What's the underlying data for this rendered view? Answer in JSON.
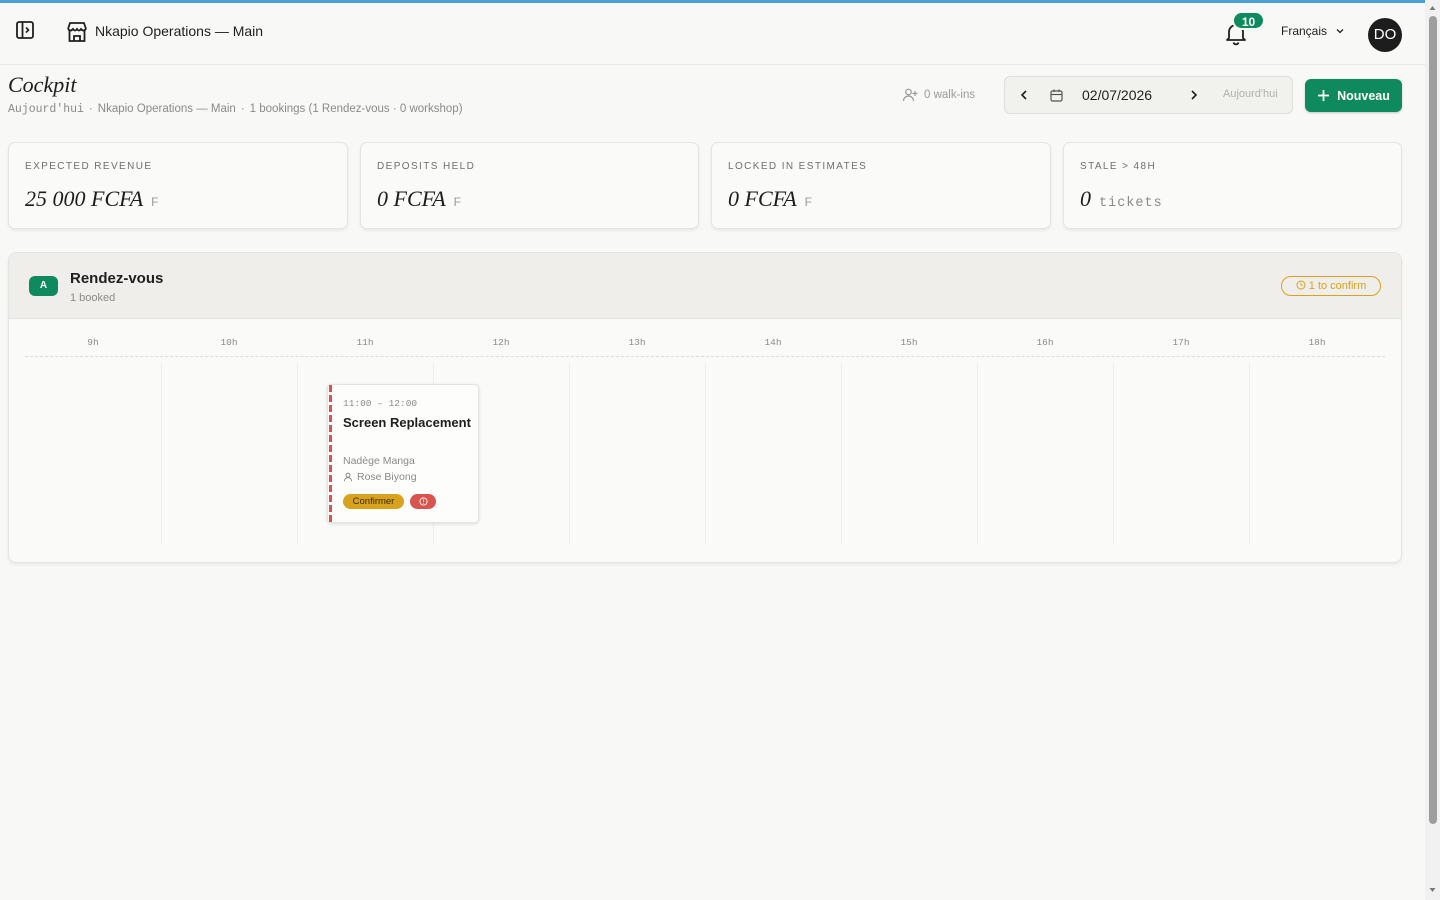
{
  "header": {
    "app_title": "Nkapio Operations — Main",
    "notification_count": "10",
    "language": "Français",
    "avatar_initials": "DO"
  },
  "page": {
    "title": "Cockpit",
    "subtitle": {
      "today": "Aujourd'hui",
      "location": "Nkapio Operations — Main",
      "bookings": "1 bookings (1 Rendez-vous · 0 workshop)"
    },
    "walkins": "0 walk-ins",
    "date": "02/07/2026",
    "today_button": "Aujourd'hui",
    "new_button": "Nouveau"
  },
  "kpis": [
    {
      "label": "Expected revenue",
      "value": "25 000 FCFA",
      "unit": "F"
    },
    {
      "label": "Deposits held",
      "value": "0 FCFA",
      "unit": "F"
    },
    {
      "label": "Locked in estimates",
      "value": "0 FCFA",
      "unit": "F"
    },
    {
      "label": "Stale > 48h",
      "value": "0",
      "unit": "tickets"
    }
  ],
  "schedule": {
    "lane_badge": "A",
    "lane_title": "Rendez-vous",
    "lane_sub": "1 booked",
    "confirm_pill": "1 to confirm",
    "hours": [
      "9h",
      "10h",
      "11h",
      "12h",
      "13h",
      "14h",
      "15h",
      "16h",
      "17h",
      "18h"
    ],
    "appointment": {
      "time": "11:00 – 12:00",
      "title": "Screen Replacement",
      "client": "Nadège Manga",
      "staff": "Rose Biyong",
      "confirm_label": "Confirmer"
    }
  },
  "colors": {
    "accent": "#0f8a5f",
    "warning": "#d9a21c",
    "danger": "#d9534f",
    "topline": "#4a9fd8"
  }
}
